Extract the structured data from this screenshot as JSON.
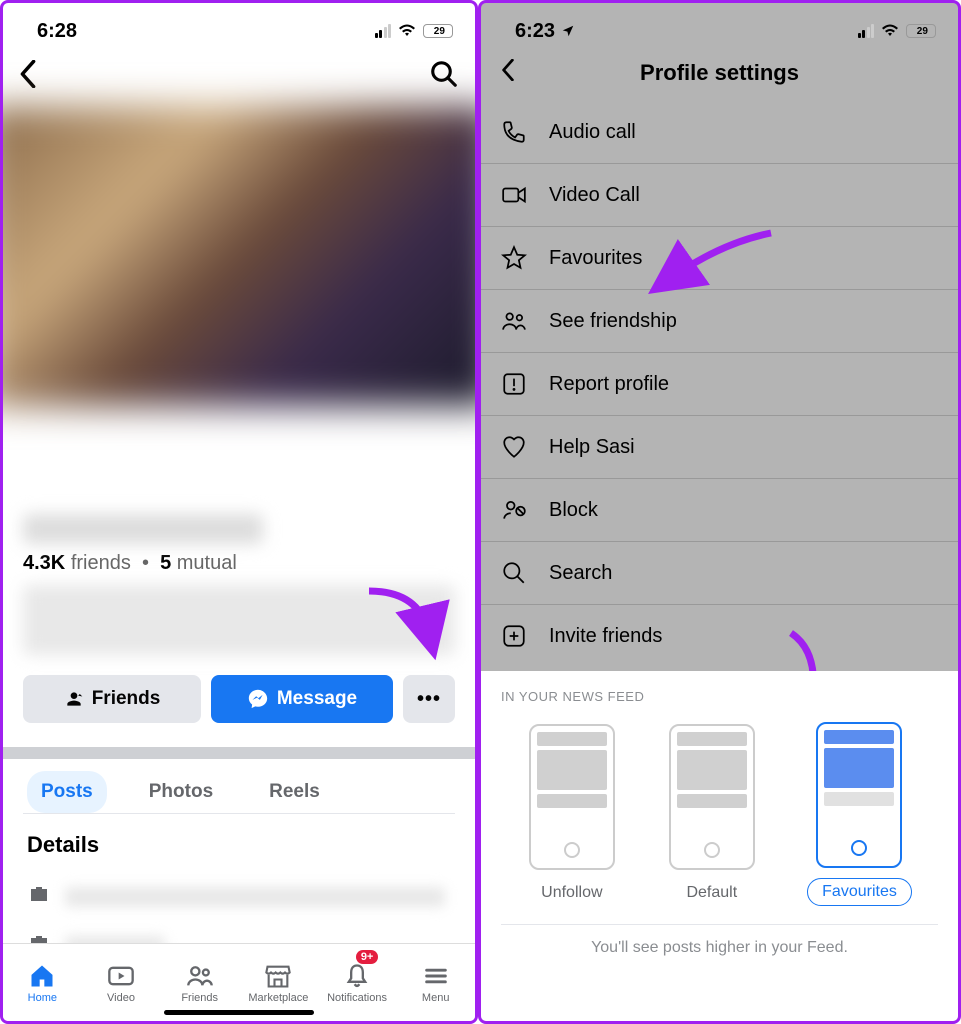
{
  "accentBlue": "#1877f2",
  "left": {
    "status": {
      "time": "6:28",
      "battery": "29"
    },
    "profile": {
      "friends_count": "4.3K",
      "friends_label": "friends",
      "mutual_count": "5",
      "mutual_label": "mutual"
    },
    "buttons": {
      "friends": "Friends",
      "message": "Message",
      "more": "•••"
    },
    "tabs": {
      "posts": "Posts",
      "photos": "Photos",
      "reels": "Reels"
    },
    "details_header": "Details",
    "bottom_nav": {
      "home": "Home",
      "video": "Video",
      "friends": "Friends",
      "marketplace": "Marketplace",
      "notifications": "Notifications",
      "notifications_badge": "9+",
      "menu": "Menu"
    }
  },
  "right": {
    "status": {
      "time": "6:23",
      "battery": "29"
    },
    "header": "Profile settings",
    "items": {
      "audio_call": "Audio call",
      "video_call": "Video Call",
      "favourites": "Favourites",
      "friendship": "See friendship",
      "report": "Report profile",
      "help": "Help Sasi",
      "block": "Block",
      "search": "Search",
      "invite": "Invite friends"
    },
    "sheet": {
      "header": "IN YOUR NEWS FEED",
      "unfollow": "Unfollow",
      "default": "Default",
      "favourites": "Favourites",
      "footer": "You'll see posts higher in your Feed."
    }
  }
}
